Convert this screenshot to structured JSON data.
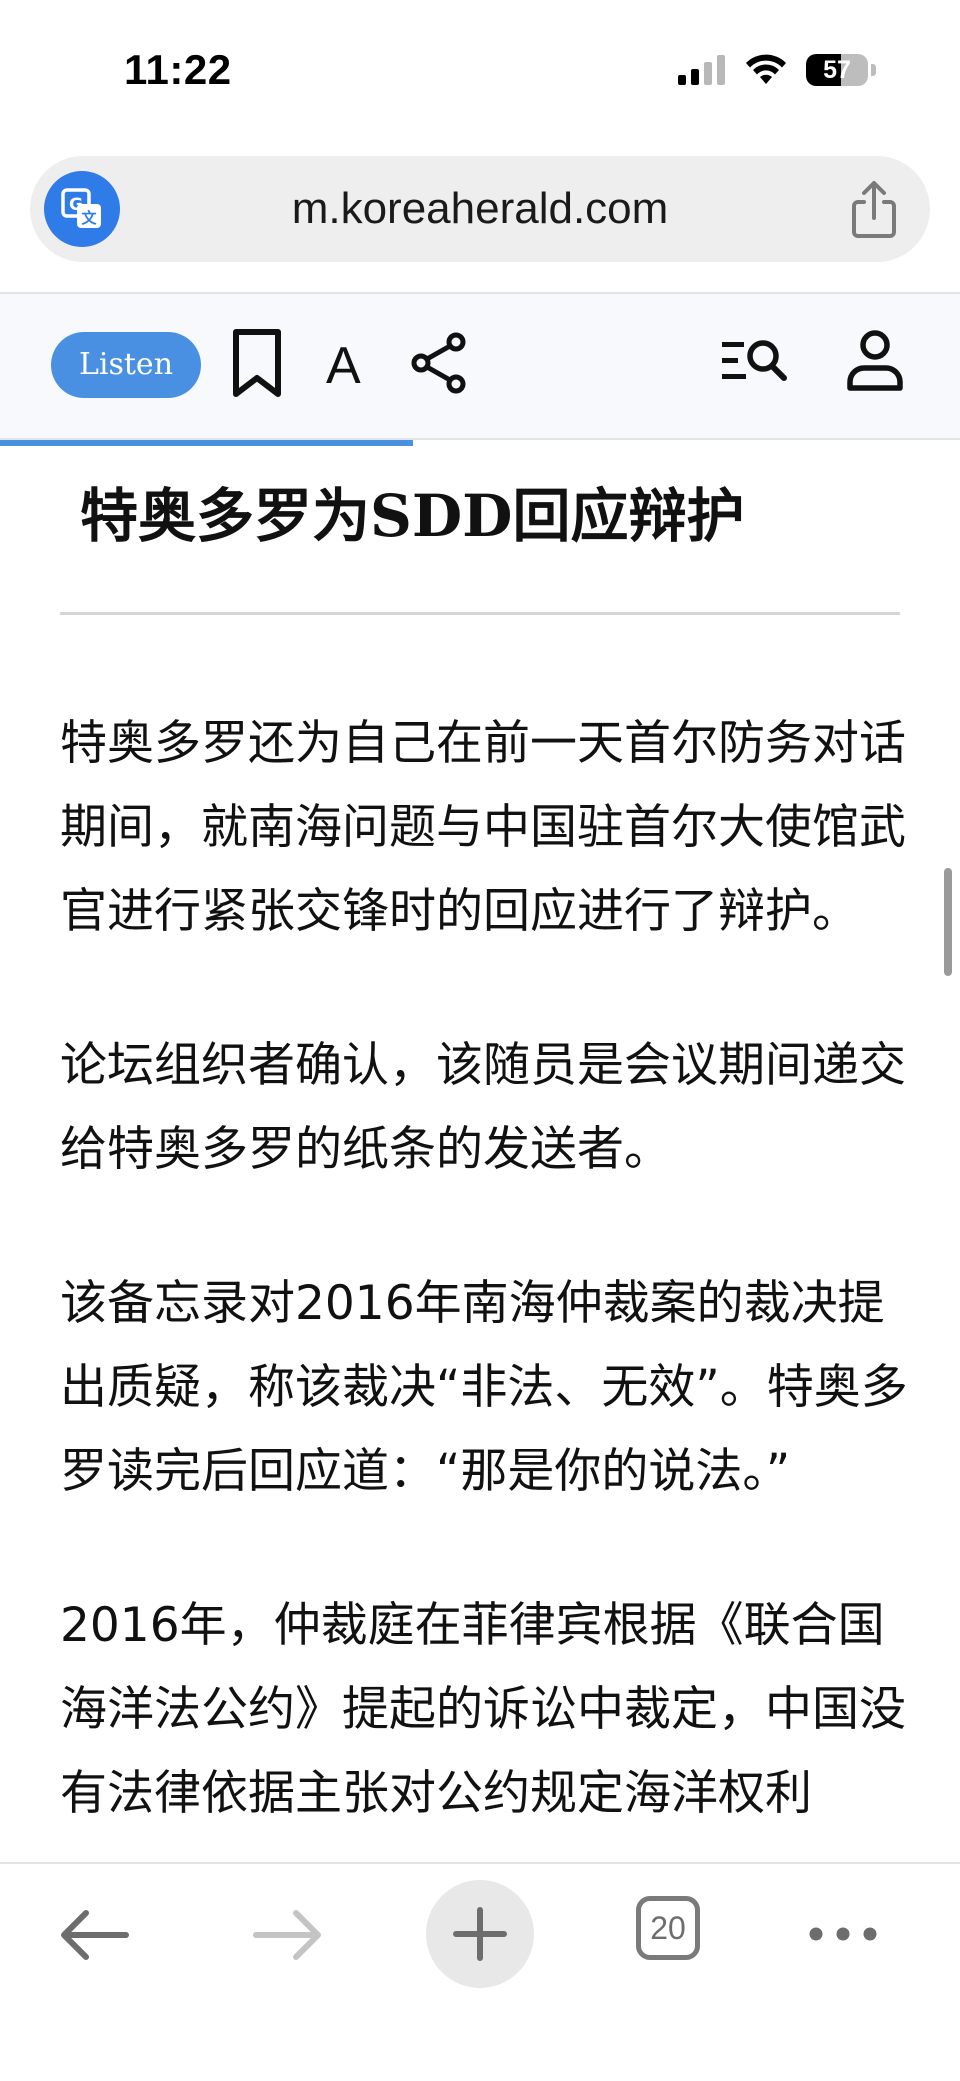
{
  "status_bar": {
    "time": "11:22",
    "battery_level": "57",
    "battery_fraction": 0.57
  },
  "browser": {
    "url": "m.koreaherald.com",
    "open_tabs": "20"
  },
  "toolbar": {
    "listen_label": "Listen",
    "font_label": "A",
    "reading_progress": 0.43
  },
  "article": {
    "title": "特奥多罗为SDD回应辩护",
    "paragraphs": [
      "特奥多罗还为自己在前一天首尔防务对话期间，就南海问题与中国驻首尔大使馆武官进行紧张交锋时的回应进行了辩护。",
      "论坛组织者确认，该随员是会议期间递交给特奥多罗的纸条的发送者。",
      "该备忘录对2016年南海仲裁案的裁决提出质疑，称该裁决“非法、无效”。特奥多罗读完后回应道：“那是你的说法。”",
      "2016年，仲裁庭在菲律宾根据《联合国海洋法公约》提起的诉讼中裁定，中国没有法律依据主张对公约规定海洋权利"
    ]
  },
  "icons": {
    "translate": "translate-icon",
    "share": "share-icon",
    "bookmark": "bookmark-icon",
    "article_share": "share-nodes-icon",
    "search_menu": "search-menu-icon",
    "account": "person-icon",
    "back": "arrow-left-icon",
    "forward": "arrow-right-icon",
    "new_tab": "plus-icon",
    "more": "more-dots-icon"
  },
  "colors": {
    "accent": "#4a90e2",
    "translate_button": "#2f7be8",
    "url_bar_bg": "#eeeeee",
    "toolbar_bg": "#f7f9fc"
  }
}
